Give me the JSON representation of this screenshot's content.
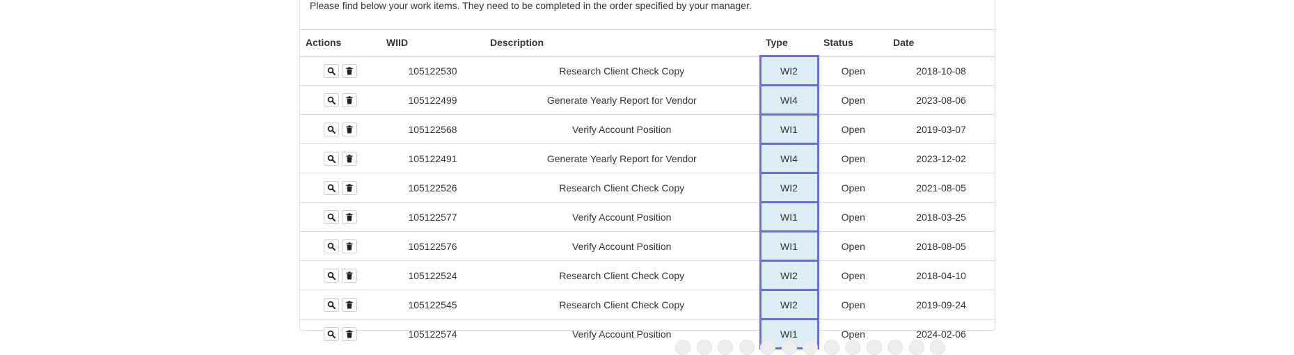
{
  "intro_text": "Please find below your work items. They need to be completed in the order specified by your manager.",
  "columns": {
    "actions": "Actions",
    "wiid": "WIID",
    "description": "Description",
    "type": "Type",
    "status": "Status",
    "date": "Date"
  },
  "action_icons": [
    "search-icon",
    "trash-icon"
  ],
  "colors": {
    "type_highlight_border": "#6a6cf0",
    "type_highlight_bg": "#dbedf5"
  },
  "rows": [
    {
      "wiid": "105122530",
      "description": "Research Client Check Copy",
      "type": "WI2",
      "status": "Open",
      "date": "2018-10-08"
    },
    {
      "wiid": "105122499",
      "description": "Generate Yearly Report for Vendor",
      "type": "WI4",
      "status": "Open",
      "date": "2023-08-06"
    },
    {
      "wiid": "105122568",
      "description": "Verify Account Position",
      "type": "WI1",
      "status": "Open",
      "date": "2019-03-07"
    },
    {
      "wiid": "105122491",
      "description": "Generate Yearly Report for Vendor",
      "type": "WI4",
      "status": "Open",
      "date": "2023-12-02"
    },
    {
      "wiid": "105122526",
      "description": "Research Client Check Copy",
      "type": "WI2",
      "status": "Open",
      "date": "2021-08-05"
    },
    {
      "wiid": "105122577",
      "description": "Verify Account Position",
      "type": "WI1",
      "status": "Open",
      "date": "2018-03-25"
    },
    {
      "wiid": "105122576",
      "description": "Verify Account Position",
      "type": "WI1",
      "status": "Open",
      "date": "2018-08-05"
    },
    {
      "wiid": "105122524",
      "description": "Research Client Check Copy",
      "type": "WI2",
      "status": "Open",
      "date": "2018-04-10"
    },
    {
      "wiid": "105122545",
      "description": "Research Client Check Copy",
      "type": "WI2",
      "status": "Open",
      "date": "2019-09-24"
    },
    {
      "wiid": "105122574",
      "description": "Verify Account Position",
      "type": "WI1",
      "status": "Open",
      "date": "2024-02-06"
    }
  ]
}
